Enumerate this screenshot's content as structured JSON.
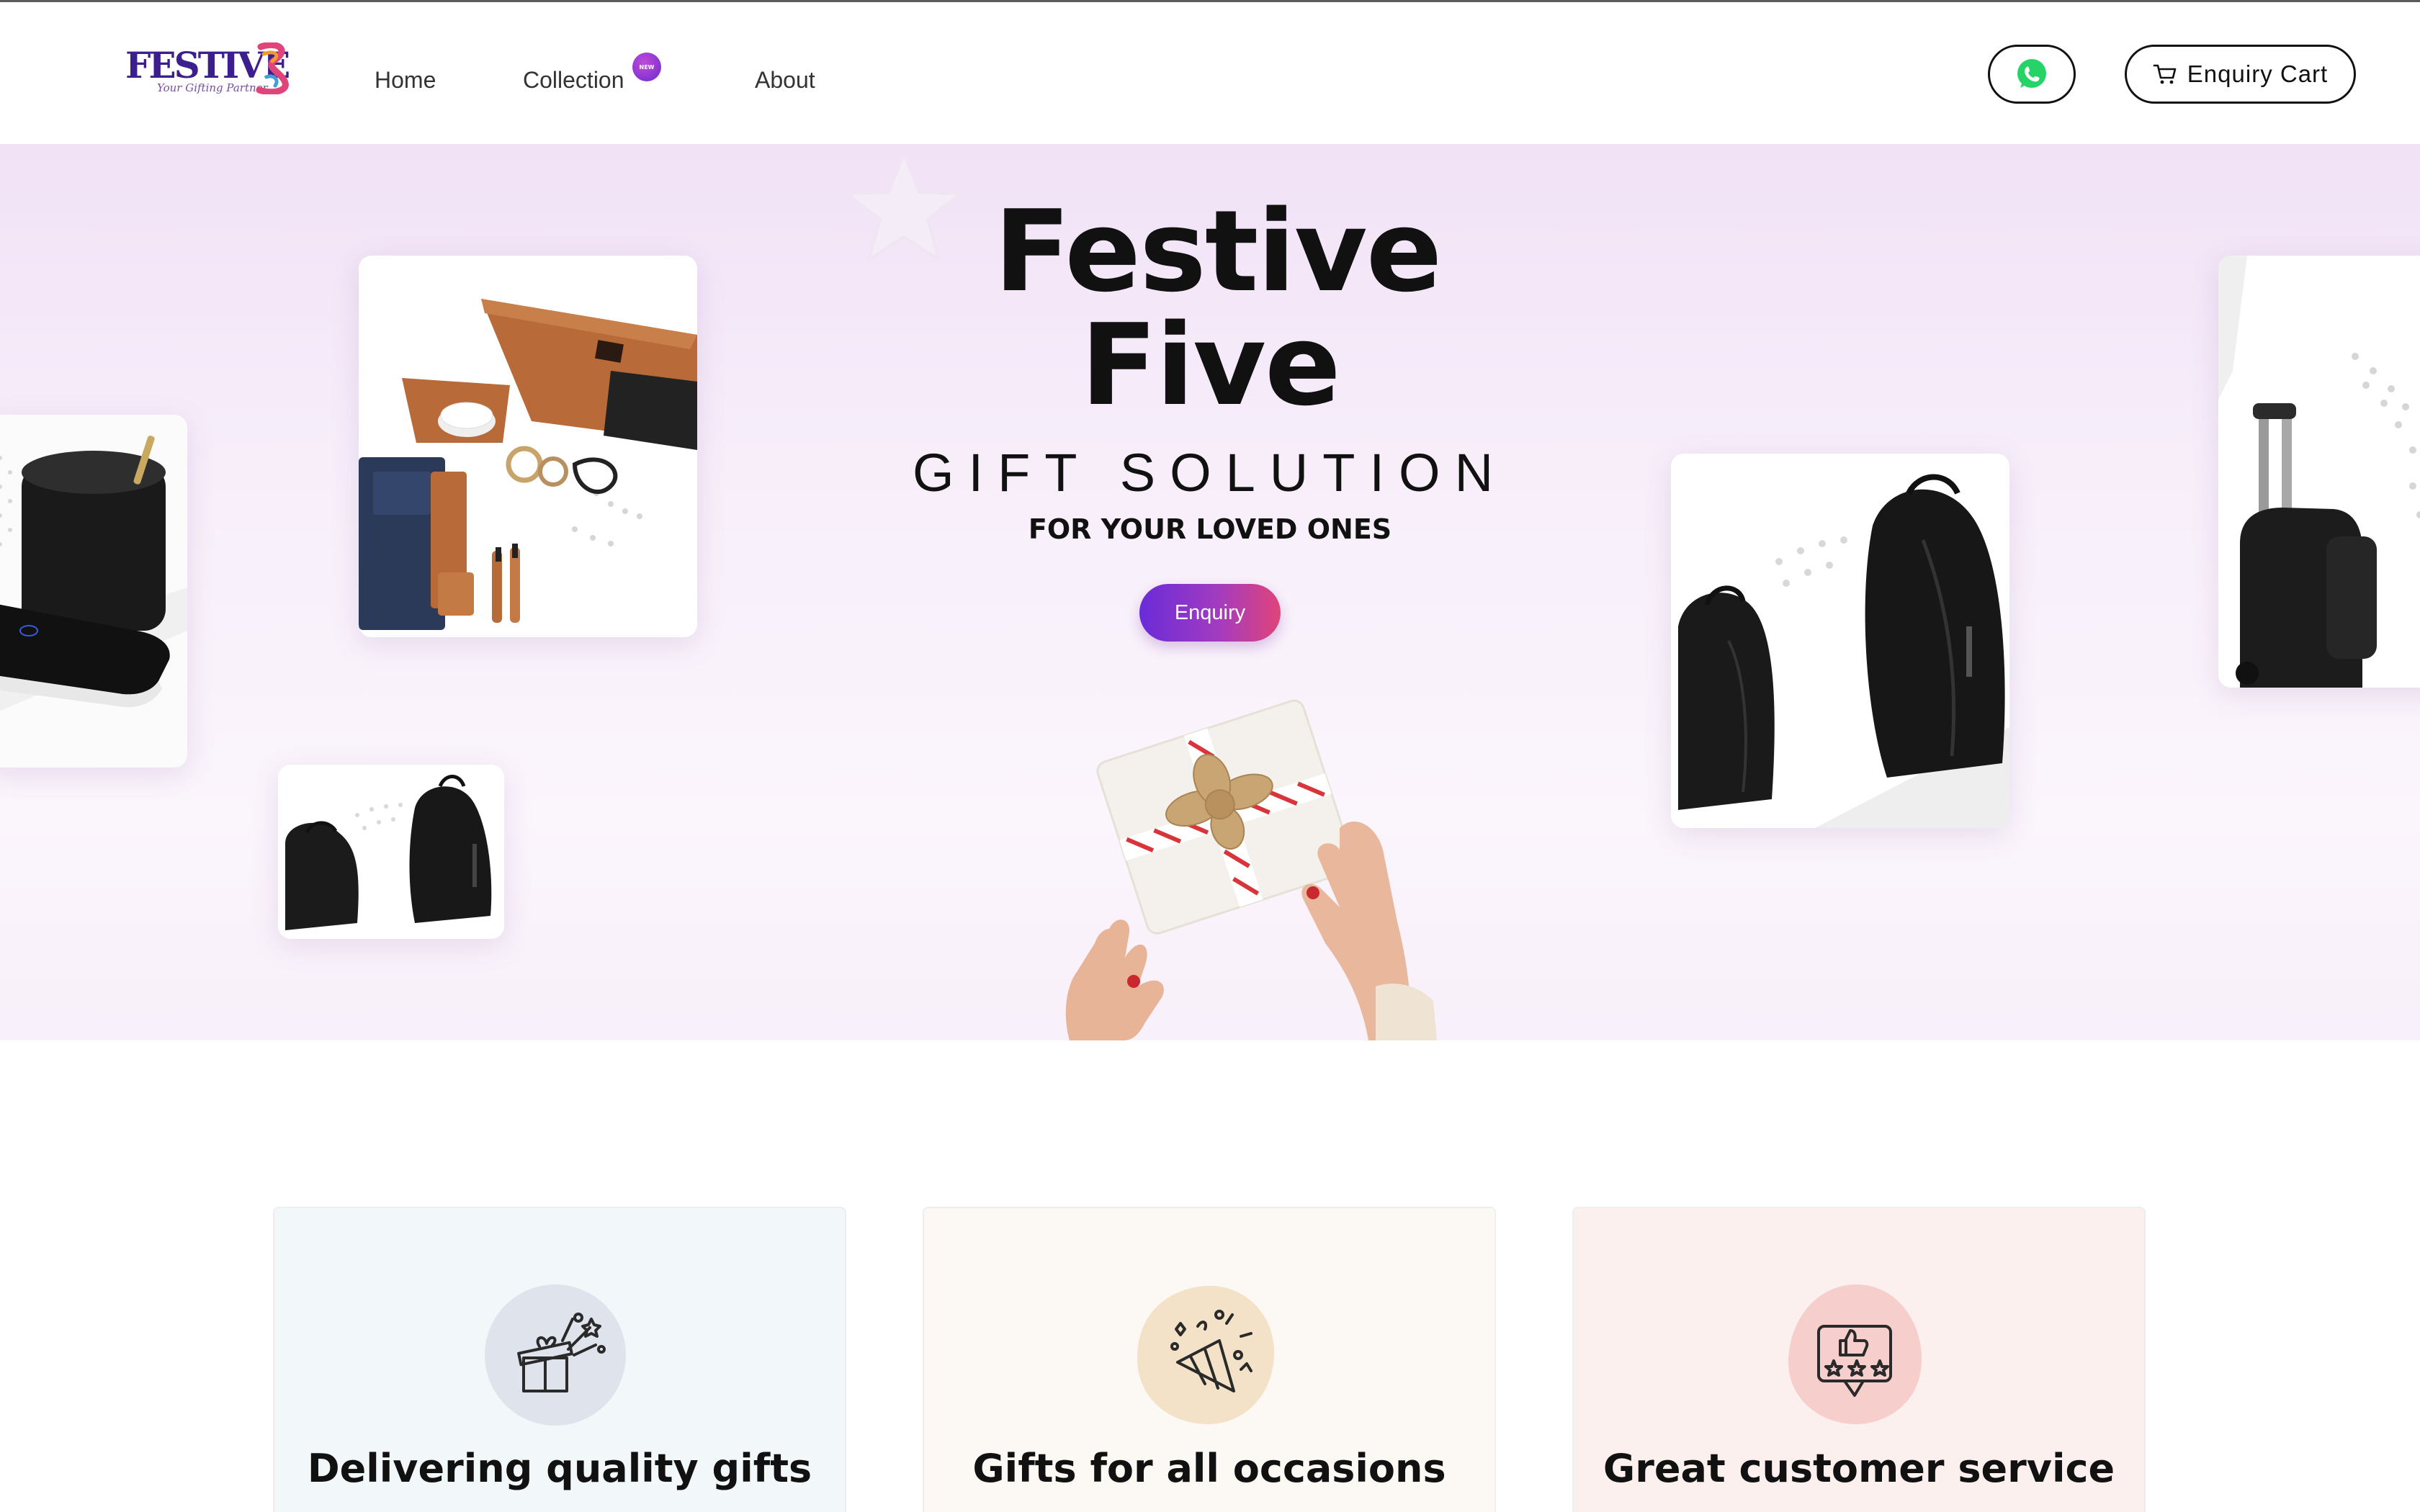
{
  "brand": {
    "name": "FESTIVE",
    "tagline": "Your Gifting Partner",
    "colors": {
      "primary": "#3b1f8f",
      "accent_pink": "#e0447a",
      "accent_purple": "#6a2bd8"
    }
  },
  "nav": {
    "items": [
      {
        "label": "Home"
      },
      {
        "label": "Collection",
        "badge": "NEW"
      },
      {
        "label": "About"
      }
    ]
  },
  "header_actions": {
    "whatsapp_icon": "whatsapp-icon",
    "cart_icon": "cart-icon",
    "cart_label": "Enquiry Cart"
  },
  "hero": {
    "title_line1": "Festive",
    "title_line2": "Five",
    "subtitle": "GIFT SOLUTION",
    "tagline": "FOR YOUR LOVED ONES",
    "cta_label": "Enquiry",
    "product_images": [
      "black-cup-warmer",
      "leather-accessory-set",
      "black-backpacks-small",
      "black-backpacks-large",
      "black-trolley-bag"
    ],
    "center_image": "gift-box-in-hands"
  },
  "features": [
    {
      "title": "Delivering quality gifts",
      "icon": "gift-box-icon",
      "color": "#dfe3ec"
    },
    {
      "title": "Gifts for all occasions",
      "icon": "party-popper-icon",
      "color": "#f4e2c8"
    },
    {
      "title": "Great customer service",
      "icon": "thumbs-up-rating-icon",
      "color": "#f6cfcc"
    }
  ]
}
